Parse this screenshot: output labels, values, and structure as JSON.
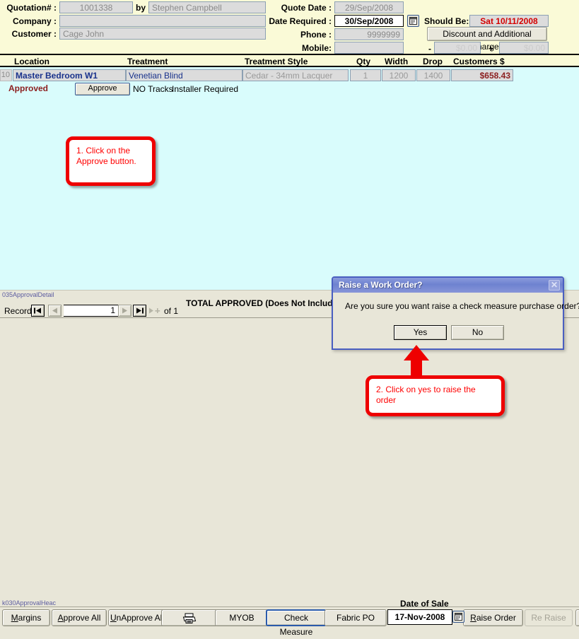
{
  "header": {
    "labels": {
      "quotation": "Quotation# :",
      "by": "by",
      "company": "Company :",
      "customer": "Customer :",
      "quote_date": "Quote Date :",
      "date_required": "Date Required :",
      "should_be": "Should Be:",
      "phone": "Phone :",
      "mobile": "Mobile:",
      "minus": "-",
      "plus": "+"
    },
    "values": {
      "quotation_number": "1001338",
      "salesperson": "Stephen Campbell",
      "company": "",
      "customer": "Cage John",
      "quote_date": "29/Sep/2008",
      "date_required": "30/Sep/2008",
      "should_be": "Sat 10/11/2008",
      "phone": "9999999",
      "mobile": "",
      "discount_amount": "$0.00",
      "additional_amount": "$0.00"
    },
    "placeholders": {
      "company": "",
      "mobile": ""
    },
    "discount_button": "Discount and Additional Charges",
    "date_picker_icon": "calendar-icon"
  },
  "table": {
    "columns": [
      "Location",
      "Treatment",
      "Treatment Style",
      "Qty",
      "Width",
      "Drop",
      "Customers $"
    ],
    "rows": [
      {
        "row_number": "10",
        "location": "Master Bedroom W1",
        "treatment": "Venetian Blind",
        "treatment_style": "Cedar - 34mm Lacquer",
        "qty": "1",
        "width": "1200",
        "drop": "1400",
        "customers_dollar": "$658.43",
        "status": "Approved",
        "approve_button": "Approve",
        "note_tracks": "NO Tracks",
        "note_installer": "Installer Required"
      }
    ]
  },
  "subform": {
    "form_code": "035ApprovalDetail",
    "total_label": "TOTAL APPROVED (Does Not Include I",
    "record_nav": {
      "label": "Record:",
      "first_icon": "first-record-icon",
      "prev_icon": "previous-record-icon",
      "next_icon": "next-record-icon",
      "last_icon": "last-record-icon",
      "new_icon": "new-record-icon",
      "current": "1",
      "of_label": "of",
      "total": "1"
    }
  },
  "dialog": {
    "title": "Raise a Work Order?",
    "close_icon": "close-icon",
    "message": "Are you sure you want raise a check measure purchase order?",
    "yes_label": "Yes",
    "no_label": "No"
  },
  "callouts": [
    {
      "id": "callout-1",
      "text": "1. Click on the Approve button."
    },
    {
      "id": "callout-2",
      "text": "2. Click on yes to raise the order"
    }
  ],
  "bottom": {
    "form_code": "k030ApprovalHeac",
    "buttons": [
      {
        "label": "Margins",
        "accel": "M",
        "state": "normal"
      },
      {
        "label": "Approve All",
        "accel": "A",
        "state": "normal"
      },
      {
        "label": "UnApprove All",
        "accel": "U",
        "state": "normal"
      },
      {
        "label": "",
        "accel": "",
        "state": "normal",
        "icon": "printer-icon"
      },
      {
        "label": "MYOB",
        "accel": "",
        "state": "normal"
      },
      {
        "label": "Check Measure",
        "accel": "",
        "state": "focused"
      },
      {
        "label": "Fabric PO",
        "accel": "",
        "state": "normal"
      },
      {
        "label": "Raise Order",
        "accel": "R",
        "state": "normal"
      },
      {
        "label": "Re Raise",
        "accel": "",
        "state": "disabled"
      }
    ],
    "date_of_sale_label": "Date of Sale",
    "date_of_sale_value": "17-Nov-2008",
    "date_picker_icon": "calendar-icon"
  },
  "colors": {
    "form_background": "#FAFAD7",
    "sheet_background": "#D9FCFC",
    "window_background": "#E8E6D8",
    "callout_red": "#EE0000",
    "money_red": "#8C2020",
    "link_blue": "#19328C",
    "dialog_blue": "#4A5FC1"
  }
}
